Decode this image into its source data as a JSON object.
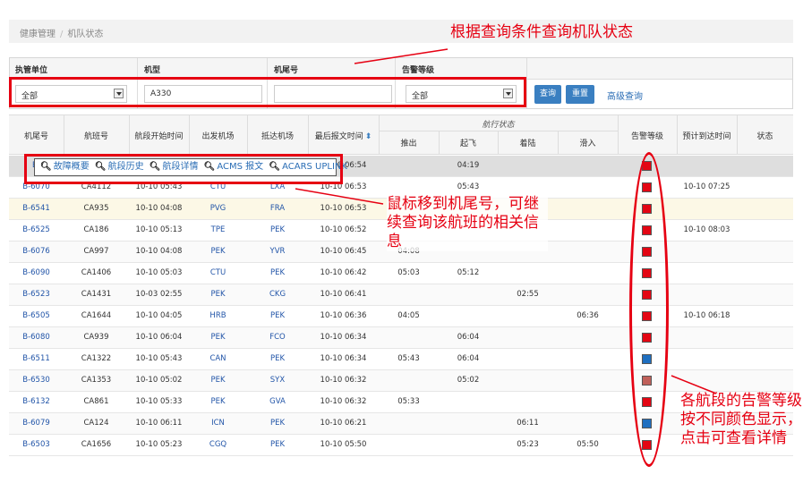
{
  "breadcrumb": {
    "items": [
      "健康管理",
      "机队状态"
    ]
  },
  "filters": {
    "labels": [
      "执管单位",
      "机型",
      "机尾号",
      "告警等级"
    ],
    "unit_value": "全部",
    "type_value": "A330",
    "tail_value": "",
    "level_value": "全部",
    "query_label": "查询",
    "reset_label": "重置",
    "advanced_label": "高级查询"
  },
  "table": {
    "headers": {
      "tail": "机尾号",
      "flight": "航班号",
      "start": "航段开始时间",
      "dep": "出发机场",
      "arr": "抵达机场",
      "last": "最后报文时间",
      "status_group": "航行状态",
      "pushback": "推出",
      "takeoff": "起飞",
      "landing": "着陆",
      "taxiin": "滑入",
      "level": "告警等级",
      "eta": "预计到达时间",
      "state": "状态"
    },
    "sort_icon": "sort-icon",
    "rows": [
      {
        "tail": "B-",
        "flight": "",
        "start": "",
        "dep": "",
        "arr": "",
        "last": "10-10 06:54",
        "pushback": "",
        "takeoff": "04:19",
        "landing": "",
        "taxiin": "",
        "level": "red",
        "eta": "",
        "state": ""
      },
      {
        "tail": "B-6070",
        "flight": "CA4112",
        "start": "10-10 05:43",
        "dep": "CTU",
        "arr": "LXA",
        "last": "10-10 06:53",
        "pushback": "",
        "takeoff": "05:43",
        "landing": "",
        "taxiin": "",
        "level": "red",
        "eta": "10-10 07:25",
        "state": ""
      },
      {
        "tail": "B-6541",
        "flight": "CA935",
        "start": "10-10 04:08",
        "dep": "PVG",
        "arr": "FRA",
        "last": "10-10 06:53",
        "pushback": "",
        "takeoff": "",
        "landing": "",
        "taxiin": "",
        "level": "red",
        "eta": "",
        "state": ""
      },
      {
        "tail": "B-6525",
        "flight": "CA186",
        "start": "10-10 05:13",
        "dep": "TPE",
        "arr": "PEK",
        "last": "10-10 06:52",
        "pushback": "",
        "takeoff": "",
        "landing": "",
        "taxiin": "",
        "level": "red",
        "eta": "10-10 08:03",
        "state": ""
      },
      {
        "tail": "B-6076",
        "flight": "CA997",
        "start": "10-10 04:08",
        "dep": "PEK",
        "arr": "YVR",
        "last": "10-10 06:45",
        "pushback": "04:08",
        "takeoff": "",
        "landing": "",
        "taxiin": "",
        "level": "red",
        "eta": "",
        "state": ""
      },
      {
        "tail": "B-6090",
        "flight": "CA1406",
        "start": "10-10 05:03",
        "dep": "CTU",
        "arr": "PEK",
        "last": "10-10 06:42",
        "pushback": "05:03",
        "takeoff": "05:12",
        "landing": "",
        "taxiin": "",
        "level": "red",
        "eta": "",
        "state": ""
      },
      {
        "tail": "B-6523",
        "flight": "CA1431",
        "start": "10-03 02:55",
        "dep": "PEK",
        "arr": "CKG",
        "last": "10-10 06:41",
        "pushback": "",
        "takeoff": "",
        "landing": "02:55",
        "taxiin": "",
        "level": "red",
        "eta": "",
        "state": ""
      },
      {
        "tail": "B-6505",
        "flight": "CA1644",
        "start": "10-10 04:05",
        "dep": "HRB",
        "arr": "PEK",
        "last": "10-10 06:36",
        "pushback": "04:05",
        "takeoff": "",
        "landing": "",
        "taxiin": "06:36",
        "level": "red",
        "eta": "10-10 06:18",
        "state": ""
      },
      {
        "tail": "B-6080",
        "flight": "CA939",
        "start": "10-10 06:04",
        "dep": "PEK",
        "arr": "FCO",
        "last": "10-10 06:34",
        "pushback": "",
        "takeoff": "06:04",
        "landing": "",
        "taxiin": "",
        "level": "red",
        "eta": "",
        "state": ""
      },
      {
        "tail": "B-6511",
        "flight": "CA1322",
        "start": "10-10 05:43",
        "dep": "CAN",
        "arr": "PEK",
        "last": "10-10 06:34",
        "pushback": "05:43",
        "takeoff": "06:04",
        "landing": "",
        "taxiin": "",
        "level": "blue",
        "eta": "",
        "state": ""
      },
      {
        "tail": "B-6530",
        "flight": "CA1353",
        "start": "10-10 05:02",
        "dep": "PEK",
        "arr": "SYX",
        "last": "10-10 06:32",
        "pushback": "",
        "takeoff": "05:02",
        "landing": "",
        "taxiin": "",
        "level": "brown",
        "eta": "",
        "state": ""
      },
      {
        "tail": "B-6132",
        "flight": "CA861",
        "start": "10-10 05:33",
        "dep": "PEK",
        "arr": "GVA",
        "last": "10-10 06:32",
        "pushback": "05:33",
        "takeoff": "",
        "landing": "",
        "taxiin": "",
        "level": "red",
        "eta": "",
        "state": ""
      },
      {
        "tail": "B-6079",
        "flight": "CA124",
        "start": "10-10 06:11",
        "dep": "ICN",
        "arr": "PEK",
        "last": "10-10 06:21",
        "pushback": "",
        "takeoff": "",
        "landing": "06:11",
        "taxiin": "",
        "level": "blue",
        "eta": "",
        "state": ""
      },
      {
        "tail": "B-6503",
        "flight": "CA1656",
        "start": "10-10 05:23",
        "dep": "CGQ",
        "arr": "PEK",
        "last": "10-10 05:50",
        "pushback": "",
        "takeoff": "",
        "landing": "05:23",
        "taxiin": "05:50",
        "level": "red",
        "eta": "",
        "state": ""
      }
    ]
  },
  "popup": {
    "items": [
      "故障概要",
      "航段历史",
      "航段详情",
      "ACMS 报文",
      "ACARS UPLINK"
    ],
    "icon": "search-icon"
  },
  "level_colors": {
    "red": "#e30613",
    "blue": "#1f6fc0",
    "brown": "#c0605a"
  },
  "annotations": {
    "top": "根据查询条件查询机队状态",
    "middle": "鼠标移到机尾号，可继续查询该航班的相关信息",
    "right": "各航段的告警等级按不同颜色显示，点击可查看详情"
  }
}
